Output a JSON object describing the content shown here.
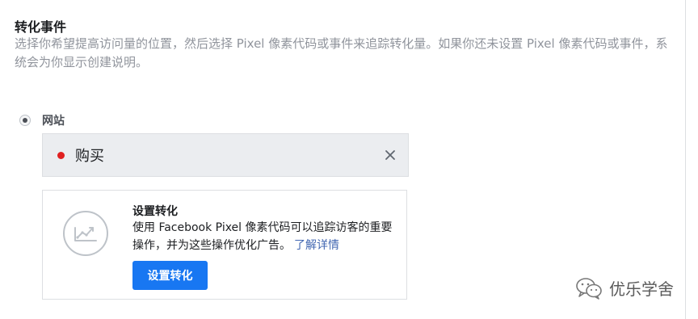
{
  "section": {
    "title": "转化事件",
    "description": "选择你希望提高访问量的位置，然后选择 Pixel 像素代码或事件来追踪转化量。如果你还未设置 Pixel 像素代码或事件，系统会为你显示创建说明。"
  },
  "radio": {
    "label": "网站",
    "selected": true
  },
  "event": {
    "label": "购买",
    "status_color": "#e02020"
  },
  "setup_card": {
    "icon": "chart-trend-icon",
    "title": "设置转化",
    "description": "使用 Facebook Pixel 像素代码可以追踪访客的重要操作，并为这些操作优化广告。",
    "link_label": "了解详情",
    "button_label": "设置转化"
  },
  "colors": {
    "accent": "#1877f2",
    "link": "#4267b2",
    "muted_text": "#90949c"
  },
  "watermark": {
    "icon": "wechat-icon",
    "text": "优乐学舍"
  }
}
